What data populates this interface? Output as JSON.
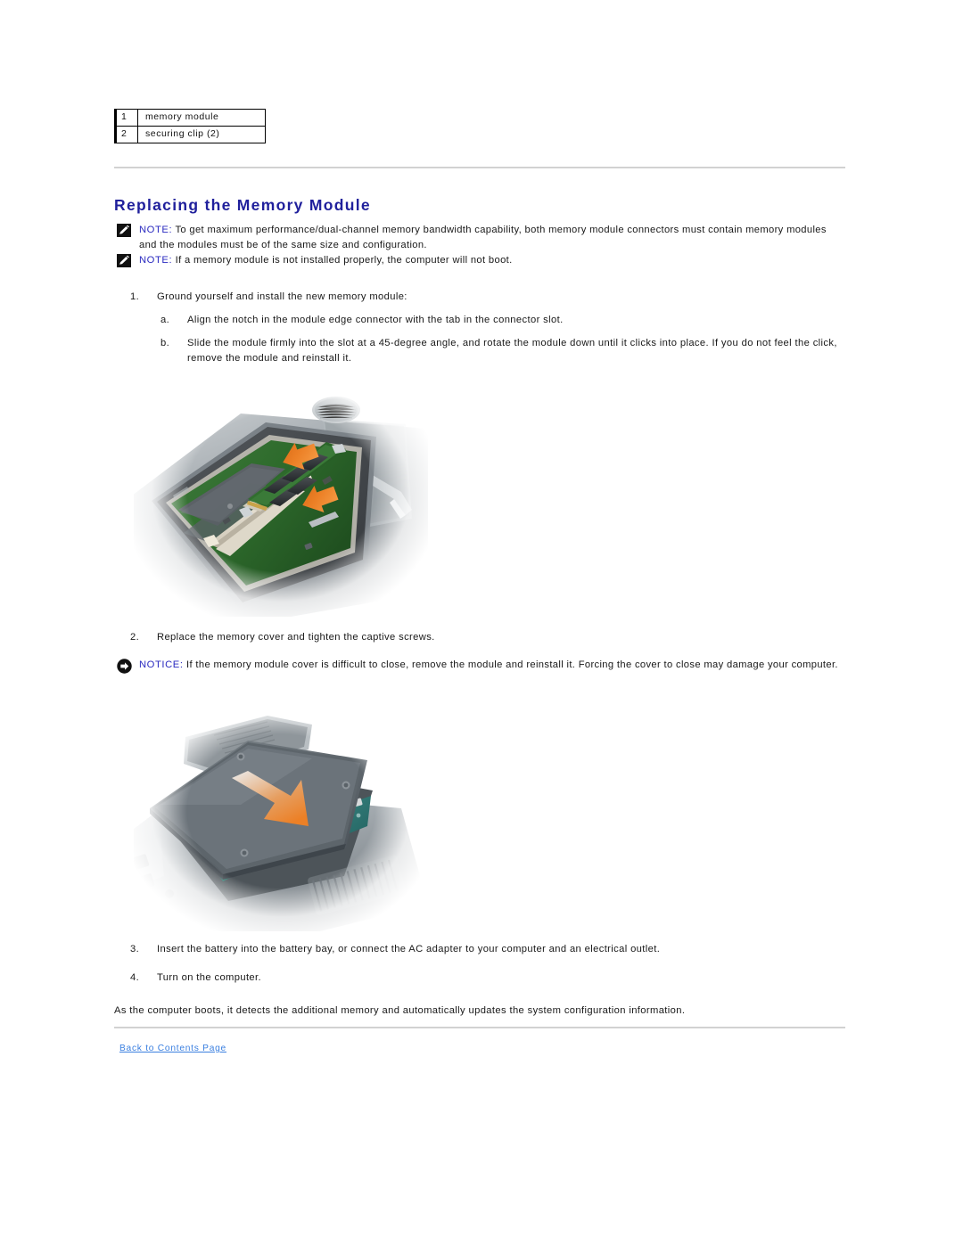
{
  "document": {
    "title": "Replacing the Memory Module"
  },
  "callout_table": {
    "rows": [
      {
        "num": "1",
        "label": "memory module"
      },
      {
        "num": "2",
        "label": "securing clip (2)"
      }
    ]
  },
  "notes": [
    {
      "tag": "NOTE:",
      "text": " To get maximum performance/dual-channel memory bandwidth capability, both memory module connectors must contain memory modules and the modules must be of the same size and configuration.",
      "icon": "pencil-icon"
    },
    {
      "tag": "NOTE:",
      "text": " If a memory module is not installed properly, the computer will not boot.",
      "icon": "pencil-icon"
    }
  ],
  "notices": [
    {
      "tag": "NOTICE:",
      "text": " If the memory module cover is difficult to close, remove the module and reinstall it. Forcing the cover to close may damage your computer.",
      "icon": "arrow-circle-icon"
    }
  ],
  "steps": {
    "step1": {
      "marker": "1.",
      "text": "Ground yourself and install the new memory module:"
    },
    "stepa": {
      "marker": "a.",
      "text": "Align the notch in the module edge connector with the tab in the connector slot."
    },
    "stepb": {
      "marker": "b.",
      "text": "Slide the module firmly into the slot at a 45-degree angle, and rotate the module down until it clicks into place. If you do not feel the click, remove the module and reinstall it."
    },
    "step2": {
      "marker": "2.",
      "text": "Replace the memory cover and tighten the captive screws."
    },
    "step3": {
      "marker": "3.",
      "text": "Insert the battery into the battery bay, or connect the AC adapter to your computer and an electrical outlet."
    },
    "step4": {
      "marker": "4.",
      "text": "Turn on the computer."
    }
  },
  "closing_paragraph": "As the computer boots, it detects the additional memory and automatically updates the system configuration information.",
  "footer": {
    "link_label": "Back to Contents Page"
  },
  "figures": [
    {
      "name": "memory-module-installation-photo",
      "caption_alt": "Memory module being inserted into the connector slot with securing clips, orange arrows indicating press-down direction"
    },
    {
      "name": "memory-cover-replacement-photo",
      "caption_alt": "Memory cover being lowered onto the memory compartment, large orange arrow indicating close direction"
    }
  ],
  "colors": {
    "heading": "#20209c",
    "tag": "#2a2ac0",
    "link": "#3a7fe0",
    "rule": "#d2d2d2",
    "arrow_orange": "#e8822a",
    "body_text": "#181818"
  }
}
